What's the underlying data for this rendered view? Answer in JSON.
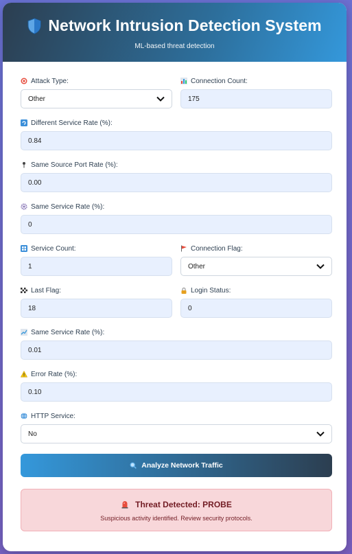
{
  "header": {
    "title": "Network Intrusion Detection System",
    "subtitle": "ML-based threat detection",
    "icon": "shield-icon"
  },
  "fields": {
    "attack_type": {
      "label": "Attack Type:",
      "value": "Other",
      "icon": "target-icon"
    },
    "connection_count": {
      "label": "Connection Count:",
      "value": "175",
      "icon": "bar-chart-icon"
    },
    "diff_service_rate": {
      "label": "Different Service Rate (%):",
      "value": "0.84",
      "icon": "refresh-icon"
    },
    "same_src_port_rate": {
      "label": "Same Source Port Rate (%):",
      "value": "0.00",
      "icon": "pin-icon"
    },
    "same_service_rate_1": {
      "label": "Same Service Rate (%):",
      "value": "0",
      "icon": "gear-icon"
    },
    "service_count": {
      "label": "Service Count:",
      "value": "1",
      "icon": "numbers-icon"
    },
    "connection_flag": {
      "label": "Connection Flag:",
      "value": "Other",
      "icon": "flag-icon"
    },
    "last_flag": {
      "label": "Last Flag:",
      "value": "18",
      "icon": "checkered-flag-icon"
    },
    "login_status": {
      "label": "Login Status:",
      "value": "0",
      "icon": "lock-icon"
    },
    "same_service_rate_2": {
      "label": "Same Service Rate (%):",
      "value": "0.01",
      "icon": "line-chart-icon"
    },
    "error_rate": {
      "label": "Error Rate (%):",
      "value": "0.10",
      "icon": "warning-icon"
    },
    "http_service": {
      "label": "HTTP Service:",
      "value": "No",
      "icon": "globe-icon"
    }
  },
  "analyze_button": {
    "label": "Analyze Network Traffic",
    "icon": "search-icon"
  },
  "result": {
    "title": "Threat Detected: PROBE",
    "message": "Suspicious activity identified. Review security protocols.",
    "icon": "alarm-icon"
  },
  "colors": {
    "header_start": "#2c3e50",
    "header_end": "#3498db",
    "input_bg": "#e8f0fe",
    "alert_bg": "#f8d7da",
    "alert_text": "#721c24"
  }
}
